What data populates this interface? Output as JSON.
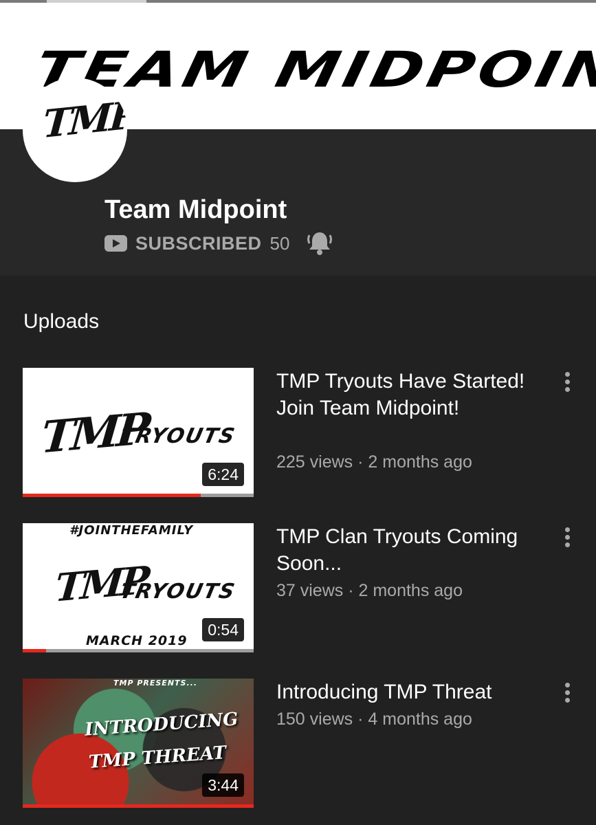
{
  "banner": {
    "text": "TEAM MIDPOINT"
  },
  "avatar": {
    "logo_text": "TMP"
  },
  "channel": {
    "name": "Team Midpoint",
    "subscribe_label": "SUBSCRIBED",
    "subscriber_count": "50"
  },
  "section": {
    "title": "Uploads"
  },
  "icons": {
    "subscribe": "youtube-icon",
    "notifications": "bell-icon",
    "more": "more-vert-icon"
  },
  "colors": {
    "accent": "#e5281e",
    "background": "#212121",
    "header": "#282828",
    "meta_text": "#aaaaaa"
  },
  "videos": [
    {
      "title": "TMP Tryouts Have Started! Join Team Midpoint!",
      "views": "225 views",
      "age": "2 months ago",
      "duration": "6:24",
      "watched_fraction": 0.77,
      "thumbnail": {
        "logo": "TMP",
        "text": "TRYOUTS"
      }
    },
    {
      "title": "TMP Clan Tryouts Coming Soon...",
      "views": "37 views",
      "age": "2 months ago",
      "duration": "0:54",
      "watched_fraction": 0.1,
      "thumbnail": {
        "logo": "TMP",
        "text": "TRYOUTS",
        "top_text": "#JOINTHEFAMILY",
        "bottom_text": "MARCH 2019"
      }
    },
    {
      "title": "Introducing TMP Threat",
      "views": "150 views",
      "age": "4 months ago",
      "duration": "3:44",
      "watched_fraction": 1.0,
      "thumbnail": {
        "top_text": "TMP PRESENTS...",
        "line1": "INTRODUCING",
        "line2": "TMP THREAT"
      }
    }
  ]
}
